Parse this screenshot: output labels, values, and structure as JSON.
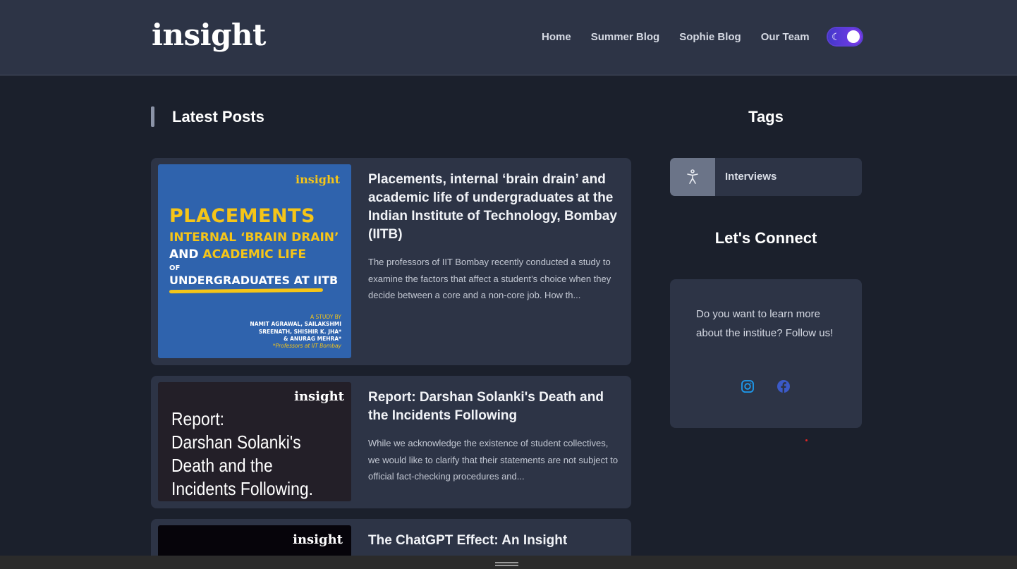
{
  "header": {
    "logo": "insight",
    "nav": [
      {
        "label": "Home"
      },
      {
        "label": "Summer Blog"
      },
      {
        "label": "Sophie Blog"
      },
      {
        "label": "Our Team"
      }
    ],
    "theme_toggle_icon": "moon-icon"
  },
  "main": {
    "section_title": "Latest Posts",
    "posts": [
      {
        "title": "Placements, internal ‘brain drain’ and academic life of undergraduates at the Indian Institute of Technology, Bombay (IITB)",
        "excerpt": "The professors of IIT Bombay recently conducted a study to examine the factors that affect a student’s choice when they decide between a core and a non-core job. How th...",
        "thumb": {
          "brand": "insight",
          "line1": "PLACEMENTS",
          "line2": "INTERNAL ‘BRAIN DRAIN’",
          "line3_a": "AND ",
          "line3_b": "ACADEMIC LIFE",
          "line4": "OF",
          "line5": "UNDERGRADUATES AT IITB",
          "study_label": "A STUDY BY",
          "authors1": "NAMIT AGRAWAL, SAILAKSHMI",
          "authors2": "SREENATH, SHISHIR K. JHA*",
          "authors3": "& ANURAG MEHRA*",
          "footnote": "*Professors at IIT Bombay"
        }
      },
      {
        "title": "Report: Darshan Solanki's Death and the Incidents Following",
        "excerpt": "While we acknowledge the existence of student collectives, we would like to clarify that their statements are not subject to official fact-checking procedures and...",
        "thumb": {
          "brand": "insight",
          "line1": "Report:",
          "line2": "Darshan Solanki's",
          "line3": "Death and the",
          "line4": "Incidents Following."
        }
      },
      {
        "title": "The ChatGPT Effect: An Insight",
        "thumb": {
          "brand": "insight"
        }
      }
    ]
  },
  "sidebar": {
    "tags_title": "Tags",
    "tags": [
      {
        "label": "Interviews",
        "icon": "accessibility-icon"
      }
    ],
    "connect_title": "Let's Connect",
    "connect_text": "Do you want to learn more about the institue? Follow us!",
    "social": [
      {
        "name": "instagram-icon",
        "color": "#1d9bf0"
      },
      {
        "name": "facebook-icon",
        "color": "#3b5ac8"
      }
    ]
  },
  "colors": {
    "background": "#1b202c",
    "header": "#2d3446",
    "card": "#2d3446",
    "accent_yellow": "#f5c518",
    "toggle": "#6d3ae8"
  }
}
